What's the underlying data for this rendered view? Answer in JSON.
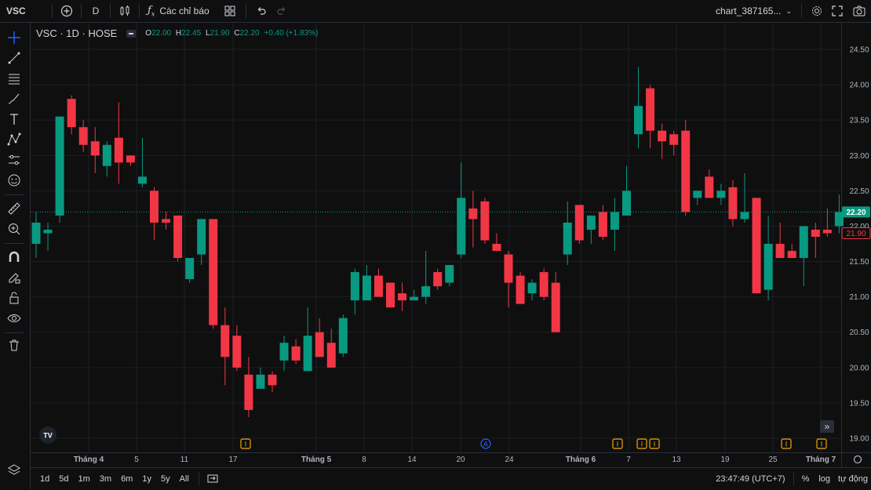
{
  "topbar": {
    "symbol": "VSC",
    "interval": "D",
    "indicators_label": "Các chỉ báo",
    "chart_name": "chart_387165..."
  },
  "legend": {
    "title": "VSC · 1D · HOSE",
    "o_label": "O",
    "o_value": "22.00",
    "h_label": "H",
    "h_value": "22.45",
    "l_label": "L",
    "l_value": "21.90",
    "c_label": "C",
    "c_value": "22.20",
    "change": "+0.40 (+1.83%)"
  },
  "price_axis": [
    "24.50",
    "24.00",
    "23.50",
    "23.00",
    "22.50",
    "22.00",
    "21.50",
    "21.00",
    "20.50",
    "20.00",
    "19.50",
    "19.00"
  ],
  "last_price_label": "22.20",
  "prev_price_label": "21.90",
  "time_axis": [
    {
      "label": "Tháng 4",
      "bold": true
    },
    {
      "label": "5",
      "bold": false
    },
    {
      "label": "11",
      "bold": false
    },
    {
      "label": "17",
      "bold": false
    },
    {
      "label": "Tháng 5",
      "bold": true
    },
    {
      "label": "8",
      "bold": false
    },
    {
      "label": "14",
      "bold": false
    },
    {
      "label": "20",
      "bold": false
    },
    {
      "label": "24",
      "bold": false
    },
    {
      "label": "Tháng 6",
      "bold": true
    },
    {
      "label": "7",
      "bold": false
    },
    {
      "label": "13",
      "bold": false
    },
    {
      "label": "19",
      "bold": false
    },
    {
      "label": "25",
      "bold": false
    },
    {
      "label": "Tháng 7",
      "bold": true
    }
  ],
  "event_markers": [
    "I",
    "A",
    "I",
    "I",
    "I",
    "I",
    "I"
  ],
  "bottombar": {
    "ranges": [
      "1d",
      "5d",
      "1m",
      "3m",
      "6m",
      "1y",
      "5y",
      "All"
    ],
    "time": "23:47:49 (UTC+7)",
    "percent": "%",
    "log": "log",
    "auto": "tự động"
  },
  "colors": {
    "up": "#089981",
    "down": "#f23645",
    "bg": "#0f0f0f",
    "grid": "#1c1f26",
    "text": "#d1d4dc"
  },
  "chart_data": {
    "type": "candlestick",
    "title": "VSC · 1D · HOSE",
    "ylim": [
      18.9,
      24.62
    ],
    "candles": [
      {
        "o": 21.75,
        "h": 22.2,
        "l": 21.55,
        "c": 22.05
      },
      {
        "o": 21.9,
        "h": 22.05,
        "l": 21.65,
        "c": 21.95
      },
      {
        "o": 22.15,
        "h": 23.55,
        "l": 22.05,
        "c": 23.55
      },
      {
        "o": 23.8,
        "h": 23.85,
        "l": 23.3,
        "c": 23.4
      },
      {
        "o": 23.4,
        "h": 23.5,
        "l": 23.05,
        "c": 23.15
      },
      {
        "o": 23.2,
        "h": 23.4,
        "l": 22.75,
        "c": 23.0
      },
      {
        "o": 22.85,
        "h": 23.2,
        "l": 22.7,
        "c": 23.15
      },
      {
        "o": 23.25,
        "h": 23.75,
        "l": 22.6,
        "c": 22.9
      },
      {
        "o": 23.0,
        "h": 23.0,
        "l": 22.85,
        "c": 22.9
      },
      {
        "o": 22.6,
        "h": 23.25,
        "l": 22.55,
        "c": 22.7
      },
      {
        "o": 22.5,
        "h": 22.55,
        "l": 21.8,
        "c": 22.05
      },
      {
        "o": 22.1,
        "h": 22.2,
        "l": 21.95,
        "c": 22.05
      },
      {
        "o": 22.15,
        "h": 22.15,
        "l": 21.5,
        "c": 21.55
      },
      {
        "o": 21.25,
        "h": 21.55,
        "l": 21.2,
        "c": 21.55
      },
      {
        "o": 21.6,
        "h": 22.1,
        "l": 21.45,
        "c": 22.1
      },
      {
        "o": 22.1,
        "h": 22.1,
        "l": 20.55,
        "c": 20.6
      },
      {
        "o": 20.6,
        "h": 20.85,
        "l": 19.75,
        "c": 20.15
      },
      {
        "o": 20.45,
        "h": 20.6,
        "l": 19.95,
        "c": 20.0
      },
      {
        "o": 19.9,
        "h": 20.15,
        "l": 19.3,
        "c": 19.4
      },
      {
        "o": 19.7,
        "h": 20.0,
        "l": 19.7,
        "c": 19.9
      },
      {
        "o": 19.9,
        "h": 19.95,
        "l": 19.65,
        "c": 19.75
      },
      {
        "o": 20.1,
        "h": 20.45,
        "l": 19.95,
        "c": 20.35
      },
      {
        "o": 20.3,
        "h": 20.4,
        "l": 20.05,
        "c": 20.1
      },
      {
        "o": 19.95,
        "h": 20.85,
        "l": 19.95,
        "c": 20.45
      },
      {
        "o": 20.5,
        "h": 20.7,
        "l": 20.15,
        "c": 20.15
      },
      {
        "o": 20.35,
        "h": 20.55,
        "l": 20.1,
        "c": 20.0
      },
      {
        "o": 20.2,
        "h": 20.75,
        "l": 20.15,
        "c": 20.7
      },
      {
        "o": 20.95,
        "h": 21.4,
        "l": 20.75,
        "c": 21.35
      },
      {
        "o": 20.95,
        "h": 21.45,
        "l": 20.95,
        "c": 21.3
      },
      {
        "o": 21.3,
        "h": 21.4,
        "l": 21.0,
        "c": 21.0
      },
      {
        "o": 21.2,
        "h": 21.2,
        "l": 20.85,
        "c": 20.85
      },
      {
        "o": 21.05,
        "h": 21.2,
        "l": 20.8,
        "c": 20.95
      },
      {
        "o": 20.95,
        "h": 21.1,
        "l": 20.95,
        "c": 21.0
      },
      {
        "o": 21.0,
        "h": 21.65,
        "l": 20.9,
        "c": 21.15
      },
      {
        "o": 21.35,
        "h": 21.4,
        "l": 21.1,
        "c": 21.15
      },
      {
        "o": 21.2,
        "h": 21.45,
        "l": 21.15,
        "c": 21.45
      },
      {
        "o": 21.6,
        "h": 22.9,
        "l": 21.55,
        "c": 22.4
      },
      {
        "o": 22.25,
        "h": 22.5,
        "l": 21.7,
        "c": 22.1
      },
      {
        "o": 22.35,
        "h": 22.4,
        "l": 21.75,
        "c": 21.8
      },
      {
        "o": 21.75,
        "h": 21.9,
        "l": 21.65,
        "c": 21.65
      },
      {
        "o": 21.6,
        "h": 21.65,
        "l": 20.85,
        "c": 21.2
      },
      {
        "o": 21.3,
        "h": 21.35,
        "l": 20.9,
        "c": 20.9
      },
      {
        "o": 21.05,
        "h": 21.25,
        "l": 20.95,
        "c": 21.2
      },
      {
        "o": 21.35,
        "h": 21.4,
        "l": 20.95,
        "c": 21.0
      },
      {
        "o": 21.2,
        "h": 21.35,
        "l": 20.5,
        "c": 20.5
      },
      {
        "o": 21.6,
        "h": 22.35,
        "l": 21.45,
        "c": 22.05
      },
      {
        "o": 22.3,
        "h": 22.3,
        "l": 21.75,
        "c": 21.8
      },
      {
        "o": 21.95,
        "h": 22.15,
        "l": 21.75,
        "c": 22.15
      },
      {
        "o": 22.2,
        "h": 22.3,
        "l": 21.8,
        "c": 21.85
      },
      {
        "o": 21.95,
        "h": 22.4,
        "l": 21.65,
        "c": 22.2
      },
      {
        "o": 22.15,
        "h": 22.85,
        "l": 22.15,
        "c": 22.5
      },
      {
        "o": 23.3,
        "h": 24.25,
        "l": 23.1,
        "c": 23.7
      },
      {
        "o": 23.95,
        "h": 24.0,
        "l": 23.1,
        "c": 23.35
      },
      {
        "o": 23.35,
        "h": 23.45,
        "l": 22.95,
        "c": 23.2
      },
      {
        "o": 23.3,
        "h": 23.35,
        "l": 23.0,
        "c": 23.15
      },
      {
        "o": 23.35,
        "h": 23.5,
        "l": 22.15,
        "c": 22.2
      },
      {
        "o": 22.4,
        "h": 22.5,
        "l": 22.3,
        "c": 22.5
      },
      {
        "o": 22.7,
        "h": 22.8,
        "l": 22.4,
        "c": 22.4
      },
      {
        "o": 22.4,
        "h": 22.6,
        "l": 22.3,
        "c": 22.5
      },
      {
        "o": 22.55,
        "h": 22.65,
        "l": 22.0,
        "c": 22.1
      },
      {
        "o": 22.1,
        "h": 22.75,
        "l": 22.05,
        "c": 22.2
      },
      {
        "o": 22.4,
        "h": 22.4,
        "l": 21.05,
        "c": 21.05
      },
      {
        "o": 21.1,
        "h": 22.15,
        "l": 20.95,
        "c": 21.75
      },
      {
        "o": 21.75,
        "h": 22.05,
        "l": 21.55,
        "c": 21.55
      },
      {
        "o": 21.65,
        "h": 21.75,
        "l": 21.55,
        "c": 21.55
      },
      {
        "o": 21.55,
        "h": 22.0,
        "l": 21.15,
        "c": 22.0
      },
      {
        "o": 21.95,
        "h": 22.05,
        "l": 21.55,
        "c": 21.85
      },
      {
        "o": 21.95,
        "h": 22.25,
        "l": 21.85,
        "c": 21.9
      },
      {
        "o": 22.0,
        "h": 22.45,
        "l": 21.9,
        "c": 22.2
      }
    ]
  }
}
